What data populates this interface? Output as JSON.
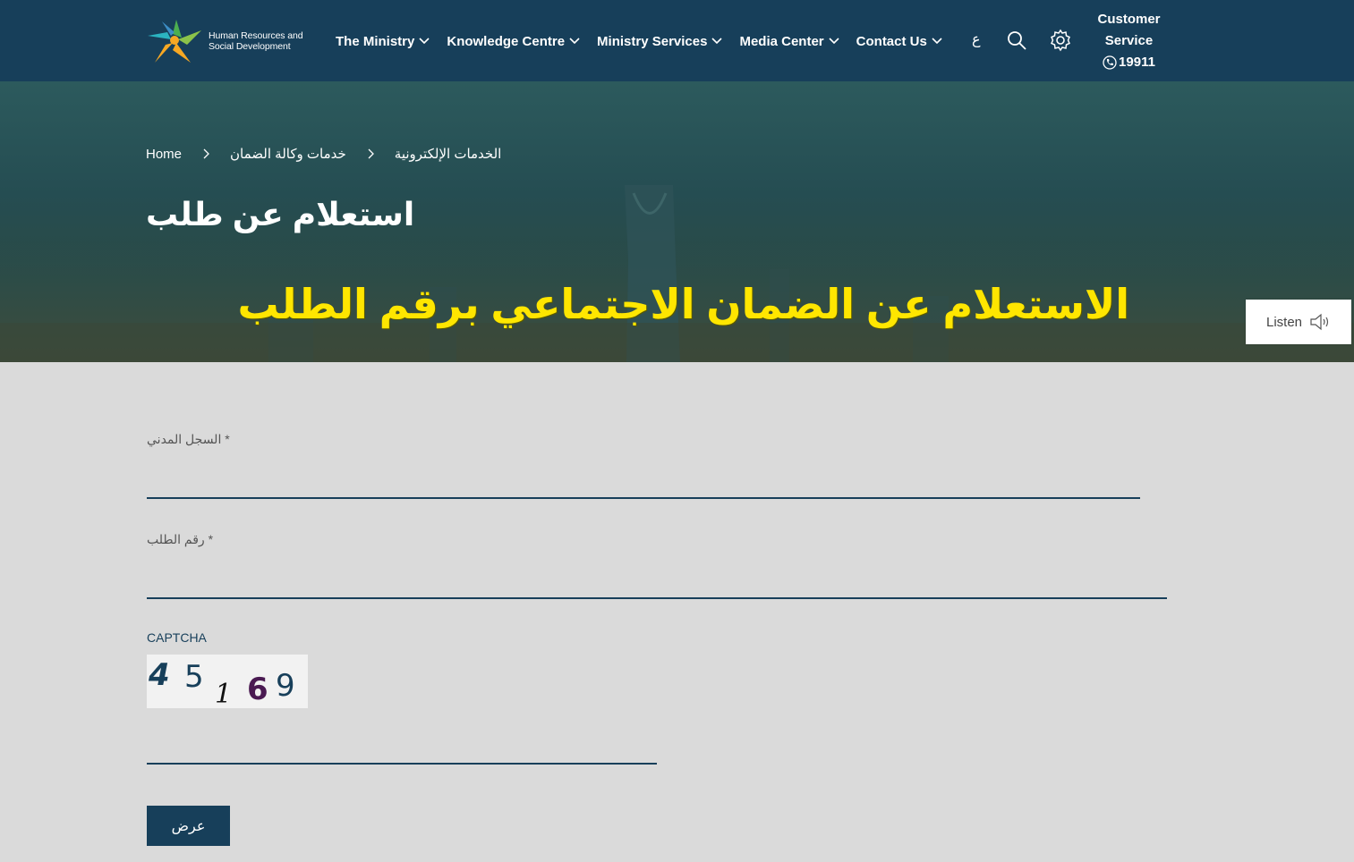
{
  "header": {
    "logo_text": "Human Resources and\nSocial Development",
    "nav": [
      "The Ministry",
      "Knowledge Centre",
      "Ministry Services",
      "Media Center",
      "Contact Us"
    ],
    "lang_toggle": "ع",
    "customer_service_line1": "Customer",
    "customer_service_line2": "Service",
    "customer_service_phone": "19911"
  },
  "breadcrumb": {
    "home": "Home",
    "level1": "خدمات وكالة الضمان",
    "level2": "الخدمات الإلكترونية"
  },
  "page_title": "استعلام عن طلب",
  "overlay_title": "الاستعلام عن الضمان الاجتماعي برقم الطلب",
  "listen_label": "Listen",
  "form": {
    "civil_registry_label": "* السجل المدني",
    "request_number_label": "* رقم الطلب",
    "captcha_label": "CAPTCHA",
    "captcha_value": "45169",
    "submit_label": "عرض"
  },
  "colors": {
    "primary": "#173f5a",
    "overlay_text": "#ffe600",
    "background": "#dadada"
  }
}
